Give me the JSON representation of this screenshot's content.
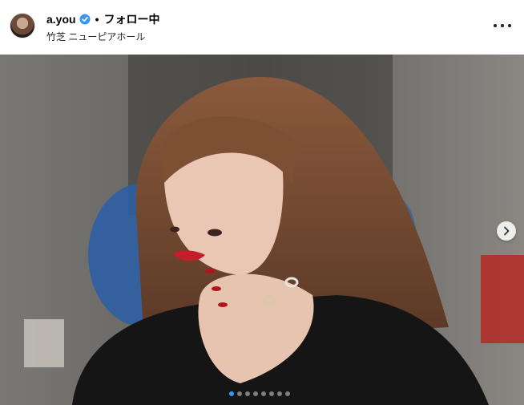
{
  "post": {
    "username": "a.you",
    "separator": "•",
    "follow_status": "フォロー中",
    "location": "竹芝 ニューピアホール"
  },
  "icons": {
    "verified": "verified-badge-icon",
    "more": "more-options-icon",
    "next": "chevron-right-icon"
  },
  "carousel": {
    "slide_count": 8,
    "active_index": 0
  },
  "colors": {
    "verified_blue": "#3897f0"
  }
}
